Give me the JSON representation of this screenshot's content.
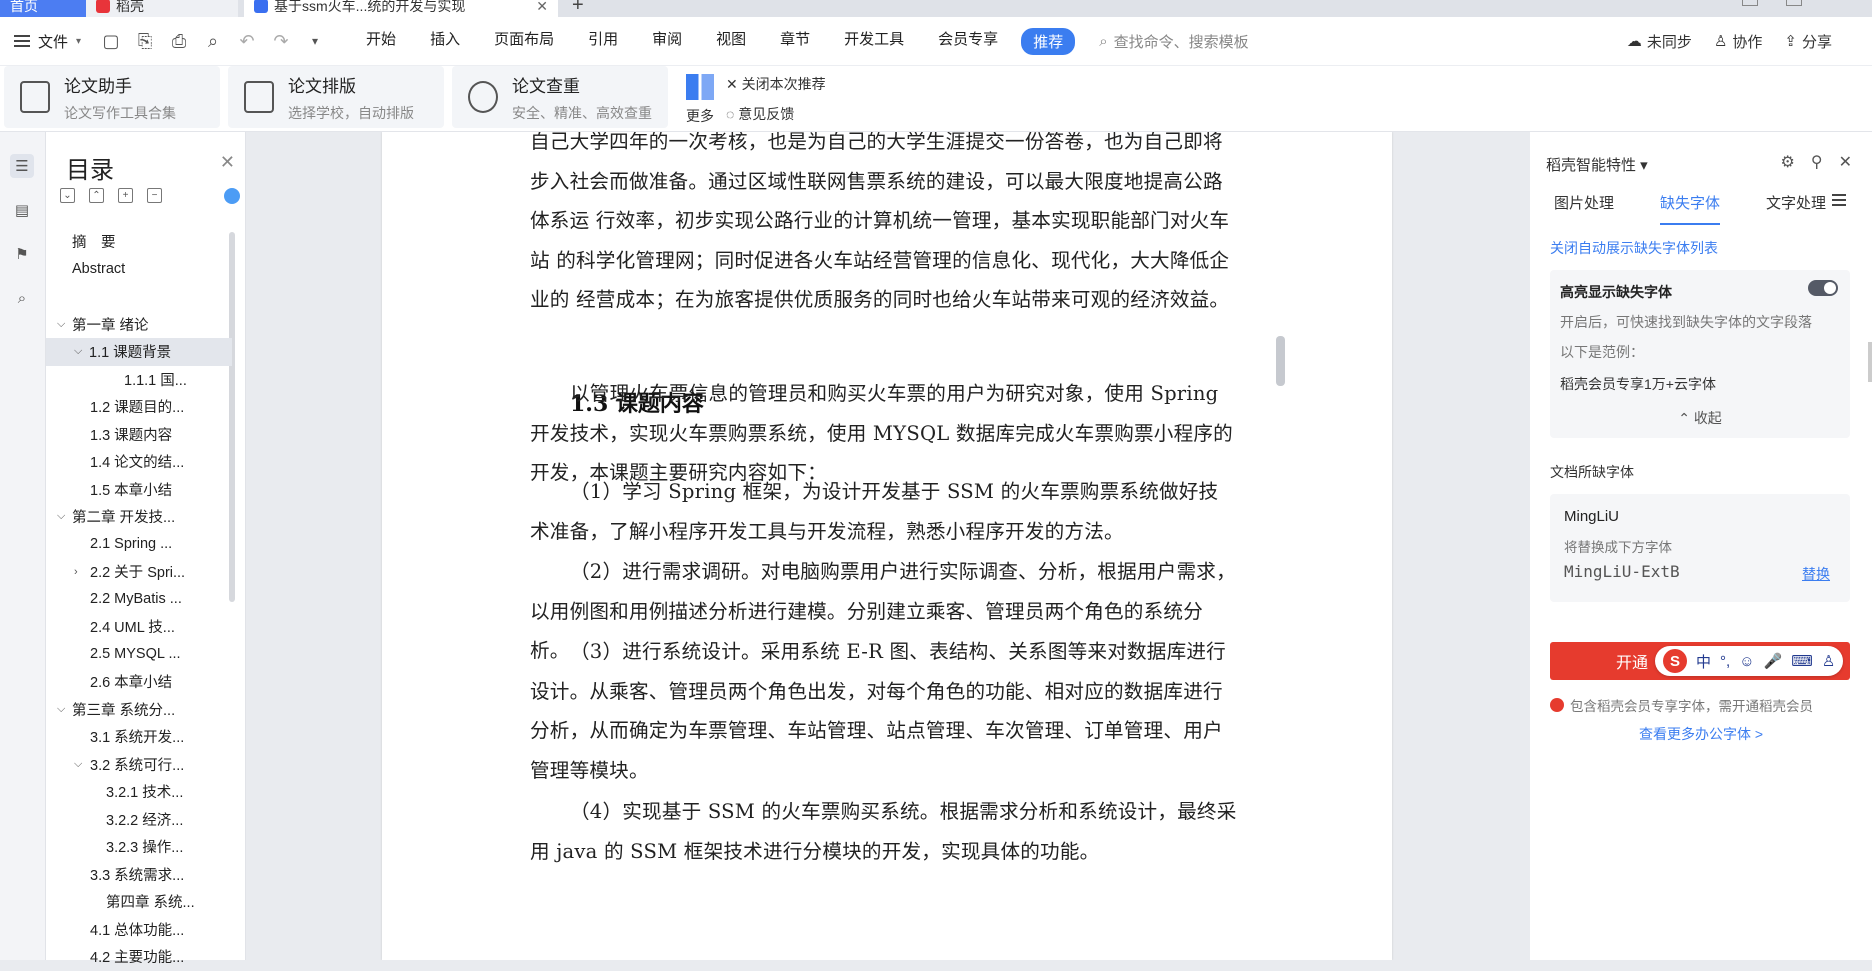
{
  "tabs": {
    "home": "首页",
    "wps": "稻壳",
    "doc": "基于ssm火车...统的开发与实现",
    "new": "+"
  },
  "menubar": {
    "file": "文件",
    "items": [
      "开始",
      "插入",
      "页面布局",
      "引用",
      "审阅",
      "视图",
      "章节",
      "开发工具",
      "会员专享"
    ],
    "active": "推荐",
    "search_placeholder": "查找命令、搜索模板",
    "sync": "未同步",
    "collab": "协作",
    "share": "分享"
  },
  "ribbon": {
    "cards": [
      {
        "title": "论文助手",
        "sub": "论文写作工具合集"
      },
      {
        "title": "论文排版",
        "sub": "选择学校，自动排版"
      },
      {
        "title": "论文查重",
        "sub": "安全、精准、高效查重"
      }
    ],
    "more": "更多",
    "close_rec": "关闭本次推荐",
    "feedback": "意见反馈"
  },
  "toc": {
    "title": "目录",
    "items": [
      {
        "label": "摘　要",
        "indent": 1
      },
      {
        "label": "Abstract",
        "indent": 1
      },
      {
        "label": "",
        "indent": 0
      },
      {
        "label": "第一章  绪论",
        "indent": 0,
        "caret": "v"
      },
      {
        "label": "1.1    课题背景",
        "indent": 1,
        "caret": "v",
        "sel": true
      },
      {
        "label": "1.1.1 国...",
        "indent": 3
      },
      {
        "label": "1.2    课题目的...",
        "indent": 2
      },
      {
        "label": "1.3    课题内容",
        "indent": 2
      },
      {
        "label": "1.4    论文的结...",
        "indent": 2
      },
      {
        "label": "1.5    本章小结",
        "indent": 2
      },
      {
        "label": "第二章    开发技...",
        "indent": 0,
        "caret": "v"
      },
      {
        "label": "2.1    Spring ...",
        "indent": 2
      },
      {
        "label": "2.2    关于 Spri...",
        "indent": 2,
        "caret": ">"
      },
      {
        "label": "2.2  MyBatis ...",
        "indent": 2
      },
      {
        "label": "2.4    UML 技...",
        "indent": 2
      },
      {
        "label": "2.5    MYSQL ...",
        "indent": 2
      },
      {
        "label": "2.6    本章小结",
        "indent": 2
      },
      {
        "label": "第三章    系统分...",
        "indent": 0,
        "caret": "v"
      },
      {
        "label": "3.1    系统开发...",
        "indent": 2
      },
      {
        "label": "3.2 系统可行...",
        "indent": 2,
        "caret": "v"
      },
      {
        "label": "3.2.1 技术...",
        "indent": 4
      },
      {
        "label": "3.2.2 经济...",
        "indent": 4
      },
      {
        "label": "3.2.3 操作...",
        "indent": 4
      },
      {
        "label": "3.3    系统需求...",
        "indent": 2
      },
      {
        "label": "第四章  系统...",
        "indent": 4
      },
      {
        "label": "4.1    总体功能...",
        "indent": 2
      },
      {
        "label": "4.2    主要功能...",
        "indent": 2
      }
    ]
  },
  "document": {
    "p1": "自己大学四年的一次考核，也是为自己的大学生涯提交一份答卷，也为自己即将步入社会而做准备。通过区域性联网售票系统的建设，可以最大限度地提高公路体系运  行效率，初步实现公路行业的计算机统一管理，基本实现职能部门对火车站  的科学化管理网；同时促进各火车站经营管理的信息化、现代化，大大降低企业的  经营成本；在为旅客提供优质服务的同时也给火车站带来可观的经济效益。",
    "heading": "1.3  课题内容",
    "p2": "以管理火车票信息的管理员和购买火车票的用户为研究对象，使用 Spring 开发技术，实现火车票购票系统，使用 MYSQL 数据库完成火车票购票小程序的开发，本课题主要研究内容如下：",
    "p3": "（1）学习 Spring 框架，为设计开发基于 SSM 的火车票购票系统做好技术准备，了解小程序开发工具与开发流程，熟悉小程序开发的方法。",
    "p4": "（2）进行需求调研。对电脑购票用户进行实际调查、分析，根据用户需求，以用例图和用例描述分析进行建模。分别建立乘客、管理员两个角色的系统分析。",
    "p5": "（3）进行系统设计。采用系统 E-R 图、表结构、关系图等来对数据库进行设计。从乘客、管理员两个角色出发，对每个角色的功能、相对应的数据库进行分析，从而确定为车票管理、车站管理、站点管理、车次管理、订单管理、用户管理等模块。",
    "p6": "（4）实现基于 SSM 的火车票购买系统。根据需求分析和系统设计，最终采用 java 的 SSM 框架技术进行分模块的开发，实现具体的功能。"
  },
  "sidepanel": {
    "title": "稻壳智能特性",
    "tabs": [
      "图片处理",
      "缺失字体",
      "文字处理"
    ],
    "active_tab": "缺失字体",
    "close_auto": "关闭自动展示缺失字体列表",
    "highlight_title": "高亮显示缺失字体",
    "highlight_desc": "开启后，可快速找到缺失字体的文字段落",
    "example_label": "以下是范例：",
    "example": "稻壳会员专享1万+云字体",
    "collapse": "收起",
    "missing_title": "文档所缺字体",
    "font_name": "MingLiU",
    "replace_hint": "将替换成下方字体",
    "replacement": "MingLiU-ExtB",
    "replace_btn": "替换",
    "vip_btn": "开通",
    "note": "包含稻壳会员专享字体，需开通稻壳会员",
    "more_fonts": "查看更多办公字体 >"
  },
  "ime": {
    "items": [
      "中",
      "°,"
    ]
  }
}
